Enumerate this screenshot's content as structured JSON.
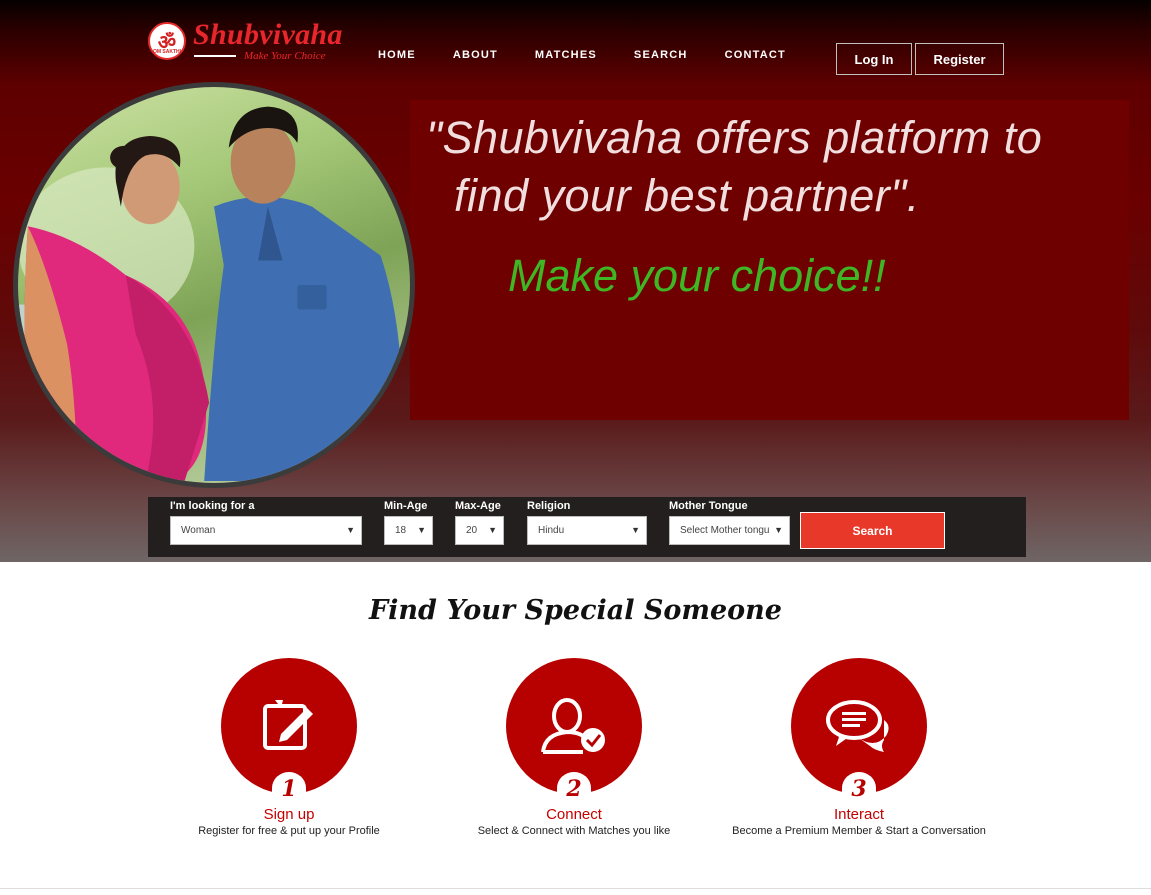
{
  "brand": {
    "name": "Shubvivaha",
    "tagline": "Make Your Choice",
    "badge_text": "OM SAKTHI"
  },
  "nav": {
    "items": [
      "HOME",
      "ABOUT",
      "MATCHES",
      "SEARCH",
      "CONTACT"
    ]
  },
  "auth": {
    "login": "Log In",
    "register": "Register"
  },
  "hero": {
    "quote_line1": "\"Shubvivaha offers platform to",
    "quote_line2": "find your best partner\".",
    "choice": "Make your choice!!"
  },
  "search": {
    "looking_label": "I'm looking for a",
    "looking_value": "Woman",
    "min_age_label": "Min-Age",
    "min_age_value": "18",
    "max_age_label": "Max-Age",
    "max_age_value": "20",
    "religion_label": "Religion",
    "religion_value": "Hindu",
    "tongue_label": "Mother Tongue",
    "tongue_placeholder": "Select Mother tongu",
    "button": "Search"
  },
  "section": {
    "title": "Find Your Special Someone"
  },
  "steps": [
    {
      "num": "1",
      "title": "Sign up",
      "desc": "Register for free & put up your Profile",
      "icon": "edit-icon"
    },
    {
      "num": "2",
      "title": "Connect",
      "desc": "Select & Connect with Matches you like",
      "icon": "user-check-icon"
    },
    {
      "num": "3",
      "title": "Interact",
      "desc": "Become a Premium Member & Start a Conversation",
      "icon": "chat-icon"
    }
  ],
  "colors": {
    "accent_red": "#b70000",
    "search_button": "#e8382a",
    "choice_green": "#3fb624"
  }
}
